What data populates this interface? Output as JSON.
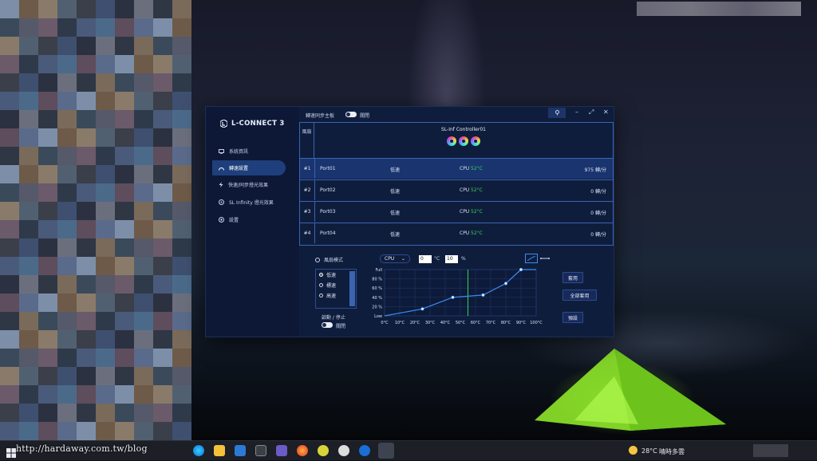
{
  "app": {
    "logo_text": "L-CONNECT 3",
    "sidebar": {
      "items": [
        {
          "label": "系統資訊",
          "icon": "monitor-icon",
          "active": false
        },
        {
          "label": "轉速設置",
          "icon": "speed-icon",
          "active": true
        },
        {
          "label": "快速/同步燈光效果",
          "icon": "bolt-icon",
          "active": false
        },
        {
          "label": "SL Infinity 燈光效果",
          "icon": "sl-infinity-icon",
          "active": false
        },
        {
          "label": "設置",
          "icon": "settings-icon",
          "active": false
        }
      ]
    },
    "topbar": {
      "sync_label": "轉速同步主板",
      "sync_state": "關閉"
    },
    "fan_panel": {
      "header_label": "風扇",
      "controller_name": "SL-Inf Controller01",
      "rows": [
        {
          "index": "#1",
          "port": "Port01",
          "mode": "低速",
          "sensor": "CPU",
          "temp": "52°C",
          "rpm": "975 轉/分",
          "selected": true
        },
        {
          "index": "#2",
          "port": "Port02",
          "mode": "低速",
          "sensor": "CPU",
          "temp": "52°C",
          "rpm": "0 轉/分",
          "selected": false
        },
        {
          "index": "#3",
          "port": "Port03",
          "mode": "低速",
          "sensor": "CPU",
          "temp": "52°C",
          "rpm": "0 轉/分",
          "selected": false
        },
        {
          "index": "#4",
          "port": "Port04",
          "mode": "低速",
          "sensor": "CPU",
          "temp": "52°C",
          "rpm": "0 轉/分",
          "selected": false
        }
      ]
    },
    "mode": {
      "title": "風扇模式",
      "options": [
        "低速",
        "標速",
        "高速"
      ],
      "selected": "低速",
      "start_stop_label": "啟動 / 停止",
      "start_stop_state": "關閉",
      "sensor_select": "CPU",
      "temp_value": "0",
      "temp_unit": "°C",
      "percent_value": "10",
      "percent_unit": "%",
      "apply_label": "套用",
      "apply_all_label": "全部套用",
      "preset_label": "預設"
    },
    "curve": {
      "y_labels": [
        "Full",
        "80 %",
        "60 %",
        "40 %",
        "20 %",
        "Low"
      ],
      "x_labels": [
        "0°C",
        "10°C",
        "20°C",
        "30°C",
        "40°C",
        "50°C",
        "60°C",
        "70°C",
        "80°C",
        "90°C",
        "100°C"
      ],
      "points": [
        [
          0,
          0
        ],
        [
          25,
          15
        ],
        [
          45,
          40
        ],
        [
          65,
          45
        ],
        [
          80,
          70
        ],
        [
          90,
          100
        ],
        [
          100,
          100
        ]
      ],
      "current_temp": 55
    }
  },
  "taskbar": {
    "weather_temp": "28°C",
    "weather_text": "晴時多雲"
  },
  "watermark": "http://hardaway.com.tw/blog"
}
